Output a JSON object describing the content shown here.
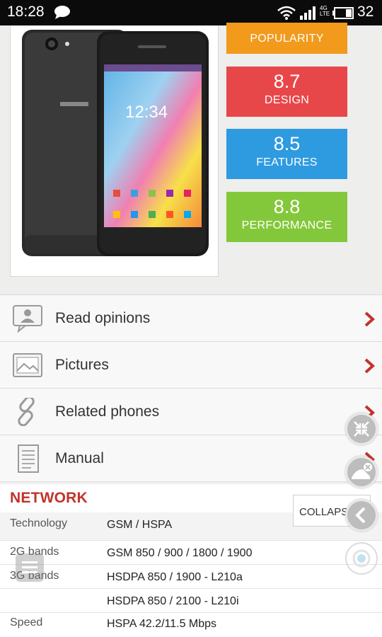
{
  "status_bar": {
    "time": "18:28",
    "network": "4G",
    "network_sub": "LTE",
    "battery": "32"
  },
  "ratings": [
    {
      "value": "",
      "label": "POPULARITY"
    },
    {
      "value": "8.7",
      "label": "DESIGN"
    },
    {
      "value": "8.5",
      "label": "FEATURES"
    },
    {
      "value": "8.8",
      "label": "PERFORMANCE"
    }
  ],
  "menu": [
    {
      "label": "Read opinions",
      "icon": "opinions-icon"
    },
    {
      "label": "Pictures",
      "icon": "pictures-icon"
    },
    {
      "label": "Related phones",
      "icon": "link-icon"
    },
    {
      "label": "Manual",
      "icon": "manual-icon"
    }
  ],
  "spec": {
    "title": "NETWORK",
    "collapse_label": "COLLAPSE",
    "rows": [
      {
        "key": "Technology",
        "value": "GSM / HSPA"
      },
      {
        "key": "2G bands",
        "value": "GSM 850 / 900 / 1800 / 1900"
      },
      {
        "key": "3G bands",
        "value": "HSDPA 850 / 1900 - L210a"
      },
      {
        "key": "",
        "value": "HSDPA 850 / 2100 - L210i"
      },
      {
        "key": "Speed",
        "value": "HSPA 42.2/11.5 Mbps"
      }
    ]
  },
  "colors": {
    "popularity": "#f19a1c",
    "design": "#e8474a",
    "features": "#2e9ae0",
    "performance": "#83c83a",
    "accent": "#c2332b"
  }
}
